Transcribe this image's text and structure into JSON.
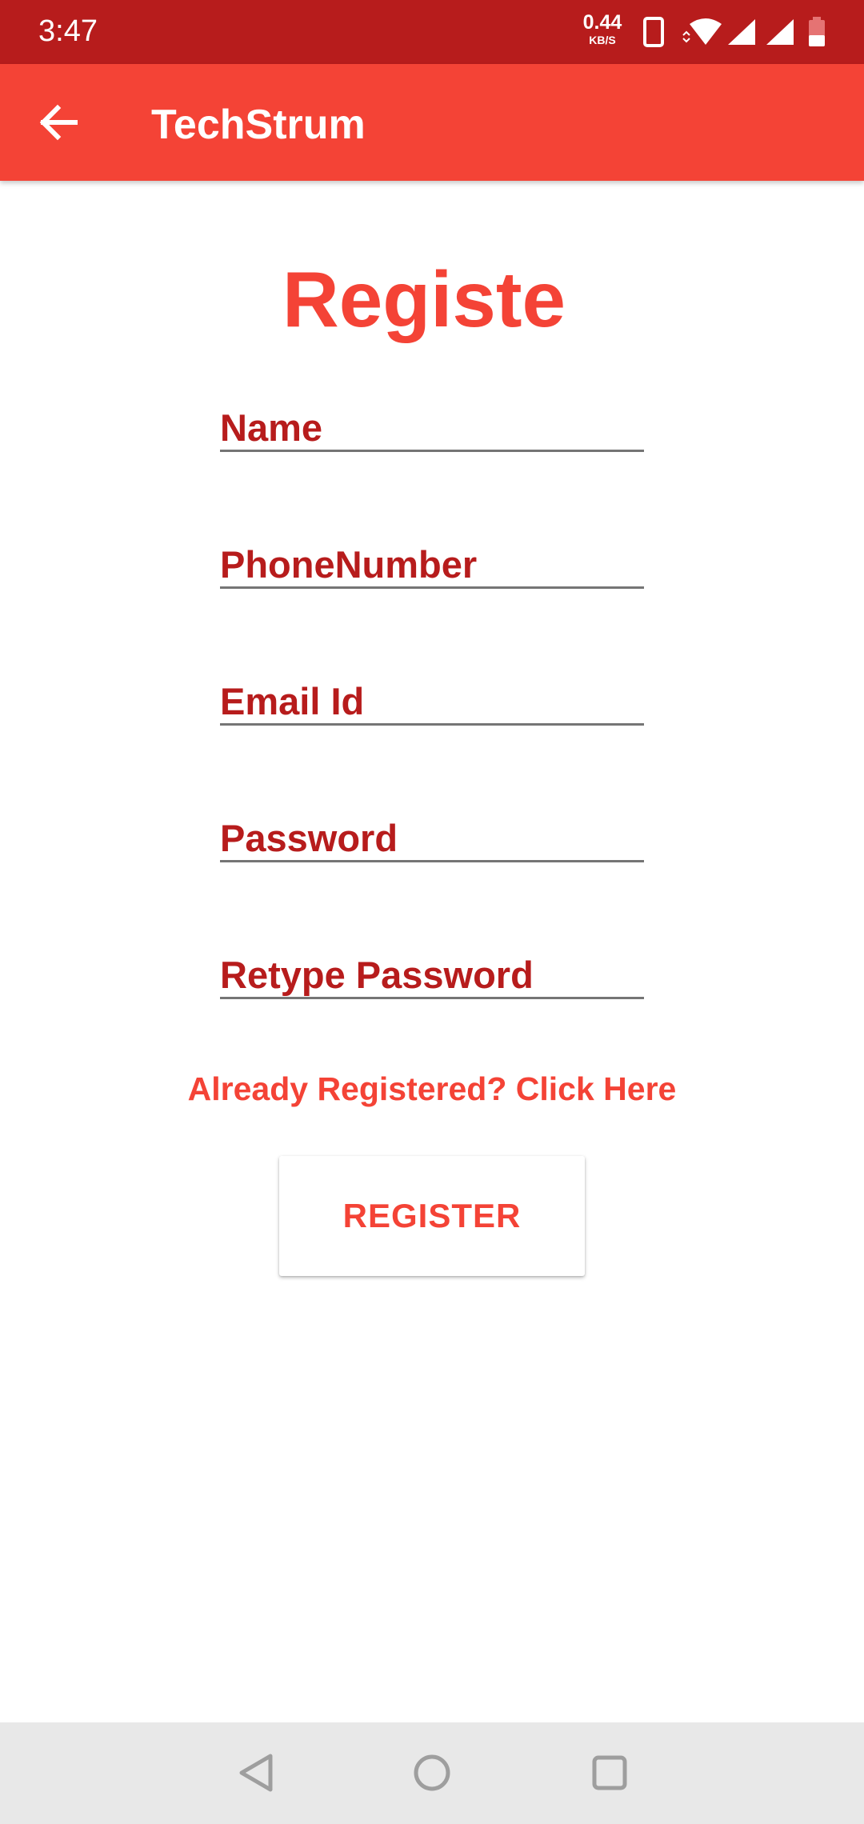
{
  "status_bar": {
    "time": "3:47",
    "net_speed_value": "0.44",
    "net_speed_unit": "KB/S",
    "icons": [
      "phone-icon",
      "wifi-icon",
      "signal-icon",
      "signal-icon",
      "battery-icon"
    ]
  },
  "app_bar": {
    "title": "TechStrum",
    "back_icon": "arrow-left-icon"
  },
  "heading": "Registe",
  "form": {
    "name_placeholder": "Name",
    "phone_placeholder": "PhoneNumber",
    "email_placeholder": "Email Id",
    "password_placeholder": "Password",
    "retype_password_placeholder": "Retype Password",
    "name_value": "",
    "phone_value": "",
    "email_value": "",
    "password_value": "",
    "retype_password_value": ""
  },
  "login_link": "Already Registered? Click Here",
  "register_button": "REGISTER",
  "nav_bar": {
    "buttons": [
      "back-triangle-icon",
      "home-circle-icon",
      "recents-square-icon"
    ]
  },
  "colors": {
    "status_bar": "#b71c1c",
    "app_bar": "#f44336",
    "accent": "#f44336",
    "field_text": "#b71c1c",
    "nav_bar": "#e8e8e8"
  }
}
